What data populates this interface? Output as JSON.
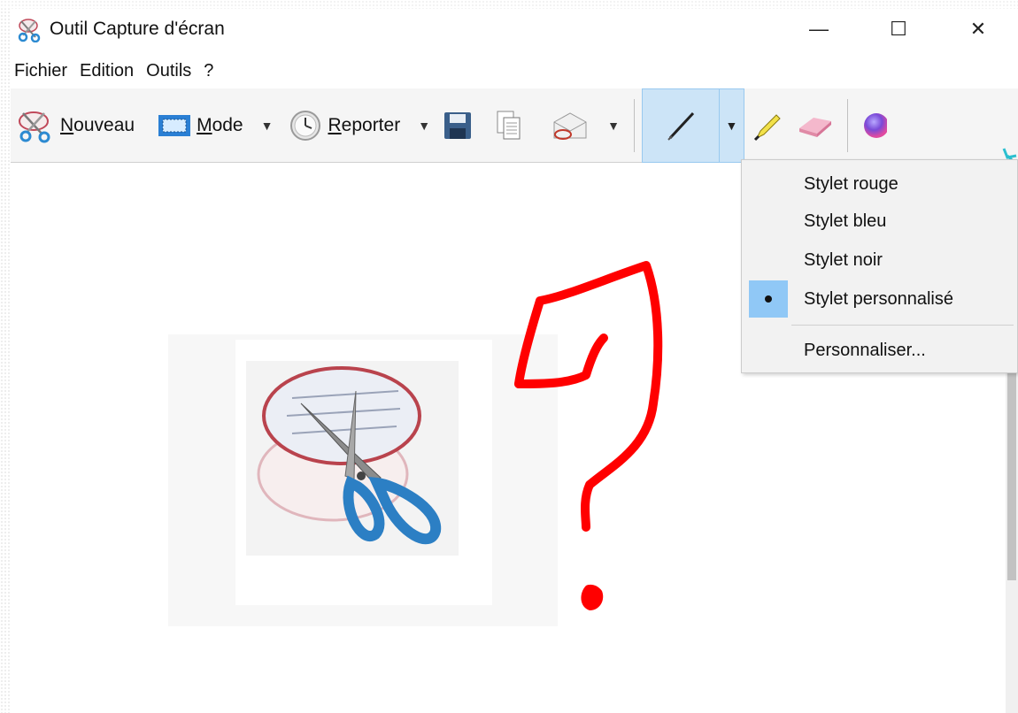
{
  "window": {
    "title": "Outil Capture d'écran",
    "minimize_symbol": "—",
    "maximize_symbol": "☐",
    "close_symbol": "✕"
  },
  "menubar": {
    "items": [
      "Fichier",
      "Edition",
      "Outils",
      "?"
    ]
  },
  "toolbar": {
    "new": {
      "mnemonic": "N",
      "rest": "ouveau",
      "icon": "scissors-icon"
    },
    "mode": {
      "mnemonic": "M",
      "rest": "ode",
      "icon": "rectangle-mode-icon"
    },
    "delay": {
      "mnemonic": "R",
      "rest": "eporter",
      "icon": "clock-icon"
    },
    "save_icon": "floppy-disk-icon",
    "copy_icon": "copy-icon",
    "send_icon": "envelope-icon",
    "pen_icon": "pen-icon",
    "highlighter_icon": "highlighter-icon",
    "eraser_icon": "eraser-icon",
    "paint3d_icon": "paint3d-icon",
    "arrow_symbol": "▼"
  },
  "pen_menu": {
    "items": [
      {
        "label": "Stylet rouge",
        "checked": false
      },
      {
        "label": "Stylet bleu",
        "checked": false
      },
      {
        "label": "Stylet noir",
        "checked": false
      },
      {
        "label": "Stylet personnalisé",
        "checked": true
      }
    ],
    "customize_label": "Personnaliser..."
  },
  "colors": {
    "pen_active_bg": "#cce4f7",
    "menu_checked_bg": "#90c8f6",
    "annotation_red": "#ff0000",
    "annotation_arrow": "#2bbfcf"
  }
}
